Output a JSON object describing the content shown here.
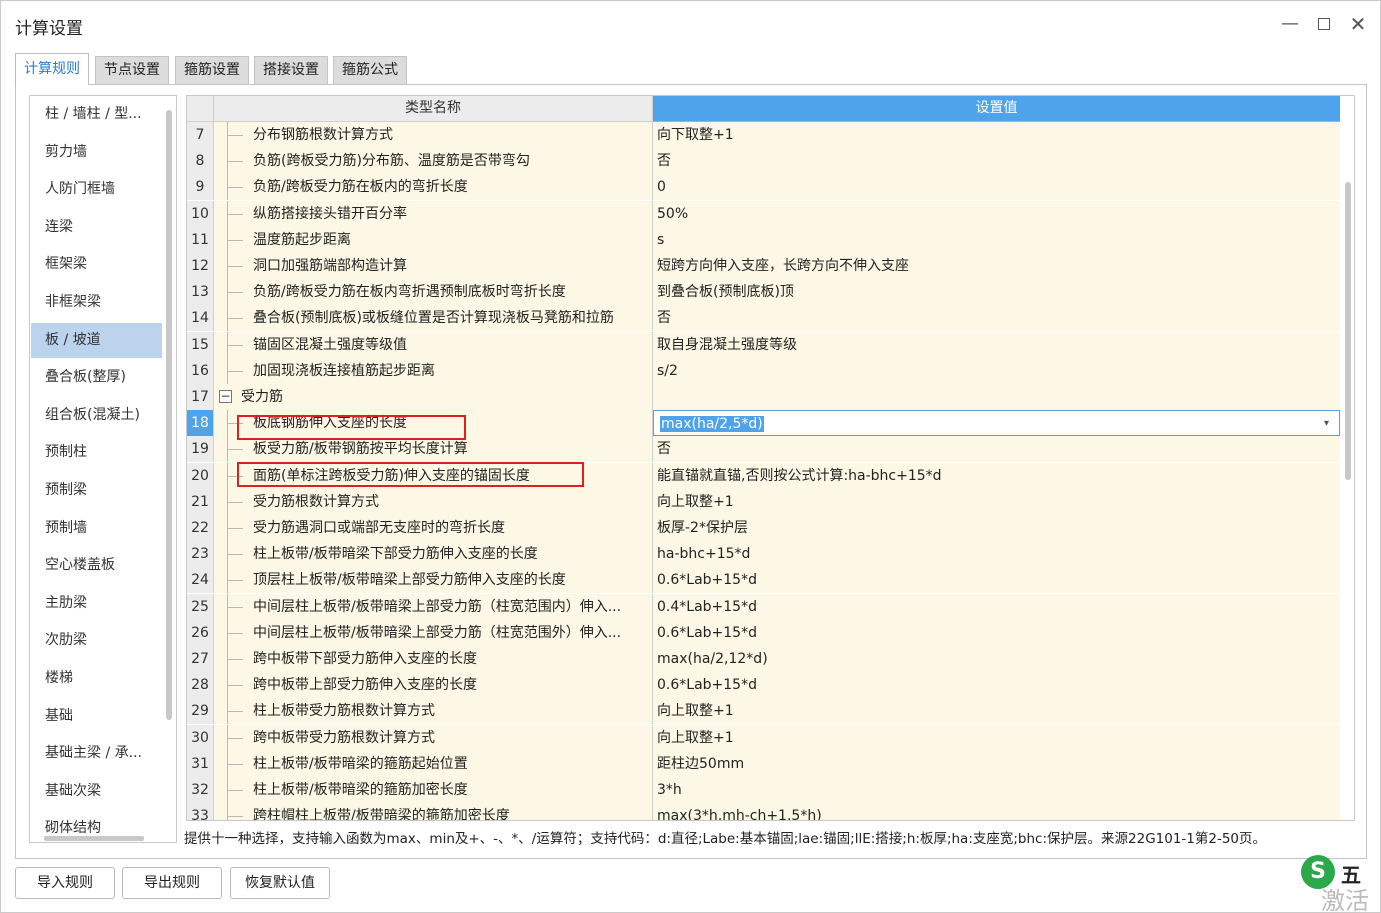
{
  "window": {
    "title": "计算设置",
    "minimize": "—",
    "close": "✕"
  },
  "tabs": [
    {
      "label": "计算规则",
      "active": true
    },
    {
      "label": "节点设置",
      "active": false
    },
    {
      "label": "箍筋设置",
      "active": false
    },
    {
      "label": "搭接设置",
      "active": false
    },
    {
      "label": "箍筋公式",
      "active": false
    }
  ],
  "sidebar": {
    "selected_index": 6,
    "items": [
      "柱 / 墙柱 / 型...",
      "剪力墙",
      "人防门框墙",
      "连梁",
      "框架梁",
      "非框架梁",
      "板 / 坡道",
      "叠合板(整厚)",
      "组合板(混凝土)",
      "预制柱",
      "预制梁",
      "预制墙",
      "空心楼盖板",
      "主肋梁",
      "次肋梁",
      "楼梯",
      "基础",
      "基础主梁 / 承...",
      "基础次梁",
      "砌体结构"
    ]
  },
  "grid": {
    "headers": {
      "name": "类型名称",
      "value": "设置值"
    },
    "rows": [
      {
        "idx": "7",
        "name": "分布钢筋根数计算方式",
        "value": "向下取整+1"
      },
      {
        "idx": "8",
        "name": "负筋(跨板受力筋)分布筋、温度筋是否带弯勾",
        "value": "否"
      },
      {
        "idx": "9",
        "name": "负筋/跨板受力筋在板内的弯折长度",
        "value": "0"
      },
      {
        "idx": "10",
        "name": "纵筋搭接接头错开百分率",
        "value": "50%"
      },
      {
        "idx": "11",
        "name": "温度筋起步距离",
        "value": "s"
      },
      {
        "idx": "12",
        "name": "洞口加强筋端部构造计算",
        "value": "短跨方向伸入支座，长跨方向不伸入支座"
      },
      {
        "idx": "13",
        "name": "负筋/跨板受力筋在板内弯折遇预制底板时弯折长度",
        "value": "到叠合板(预制底板)顶"
      },
      {
        "idx": "14",
        "name": "叠合板(预制底板)或板缝位置是否计算现浇板马凳筋和拉筋",
        "value": "否"
      },
      {
        "idx": "15",
        "name": "锚固区混凝土强度等级值",
        "value": "取自身混凝土强度等级"
      },
      {
        "idx": "16",
        "name": "加固现浇板连接植筋起步距离",
        "value": "s/2"
      },
      {
        "idx": "17",
        "name": "受力筋",
        "value": "",
        "group": true,
        "collapse_symbol": "−"
      },
      {
        "idx": "18",
        "name": "板底钢筋伸入支座的长度",
        "value": "max(ha/2,5*d)",
        "current": true,
        "caret": "▾"
      },
      {
        "idx": "19",
        "name": "板受力筋/板带钢筋按平均长度计算",
        "value": "否"
      },
      {
        "idx": "20",
        "name": "面筋(单标注跨板受力筋)伸入支座的锚固长度",
        "value": "能直锚就直锚,否则按公式计算:ha-bhc+15*d"
      },
      {
        "idx": "21",
        "name": "受力筋根数计算方式",
        "value": "向上取整+1"
      },
      {
        "idx": "22",
        "name": "受力筋遇洞口或端部无支座时的弯折长度",
        "value": "板厚-2*保护层"
      },
      {
        "idx": "23",
        "name": "柱上板带/板带暗梁下部受力筋伸入支座的长度",
        "value": "ha-bhc+15*d"
      },
      {
        "idx": "24",
        "name": "顶层柱上板带/板带暗梁上部受力筋伸入支座的长度",
        "value": "0.6*Lab+15*d"
      },
      {
        "idx": "25",
        "name": "中间层柱上板带/板带暗梁上部受力筋（柱宽范围内）伸入...",
        "value": "0.4*Lab+15*d"
      },
      {
        "idx": "26",
        "name": "中间层柱上板带/板带暗梁上部受力筋（柱宽范围外）伸入...",
        "value": "0.6*Lab+15*d"
      },
      {
        "idx": "27",
        "name": "跨中板带下部受力筋伸入支座的长度",
        "value": "max(ha/2,12*d)"
      },
      {
        "idx": "28",
        "name": "跨中板带上部受力筋伸入支座的长度",
        "value": "0.6*Lab+15*d"
      },
      {
        "idx": "29",
        "name": "柱上板带受力筋根数计算方式",
        "value": "向上取整+1"
      },
      {
        "idx": "30",
        "name": "跨中板带受力筋根数计算方式",
        "value": "向上取整+1"
      },
      {
        "idx": "31",
        "name": "柱上板带/板带暗梁的箍筋起始位置",
        "value": "距柱边50mm"
      },
      {
        "idx": "32",
        "name": "柱上板带/板带暗梁的箍筋加密长度",
        "value": "3*h"
      },
      {
        "idx": "33",
        "name": "跨柱帽柱上板带/板带暗梁的箍筋加密长度",
        "value": "max(3*h,mh-ch+1.5*h)"
      }
    ]
  },
  "hint": "提供十一种选择，支持输入函数为max、min及+、-、*、/运算符；支持代码：d:直径;Labe:基本锚固;lae:锚固;llE:搭接;h:板厚;ha:支座宽;bhc:保护层。来源22G101-1第2-50页。",
  "buttons": {
    "import": "导入规则",
    "export": "导出规则",
    "restore": "恢复默认值"
  },
  "watermark": {
    "logo": "S",
    "text": "五",
    "sub": "激活"
  },
  "colors": {
    "accent": "#4fa3ea",
    "cell_bg": "#fdf8e6",
    "highlight": "#e02020",
    "sidebar_selected": "#bcd3ee"
  }
}
